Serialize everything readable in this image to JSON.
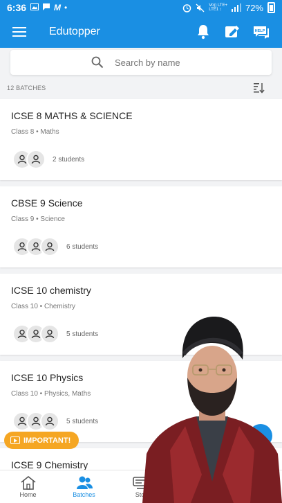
{
  "status_bar": {
    "time": "6:36",
    "network": "Vo)) LTE+\nLTE1 ↕",
    "battery": "72%"
  },
  "app_bar": {
    "title": "Edutopper",
    "icons": [
      "menu-icon",
      "bell-icon",
      "edit-icon",
      "help-icon"
    ],
    "help_badge": "HELP"
  },
  "search": {
    "placeholder": "Search by name"
  },
  "batches": {
    "count_label": "12 BATCHES",
    "items": [
      {
        "name": "ICSE 8 MATHS & SCIENCE",
        "subtitle": "Class 8 • Maths",
        "students": "2 students",
        "avatars": 2
      },
      {
        "name": "CBSE 9 Science",
        "subtitle": "Class 9 • Science",
        "students": "6 students",
        "avatars": 3
      },
      {
        "name": "ICSE 10 chemistry",
        "subtitle": "Class 10 • Chemistry",
        "students": "5 students",
        "avatars": 3
      },
      {
        "name": "ICSE 10 Physics",
        "subtitle": "Class 10 • Physics, Maths",
        "students": "5 students",
        "avatars": 3
      },
      {
        "name": "ICSE 9 Chemistry",
        "subtitle": "",
        "students": "",
        "avatars": 0
      }
    ]
  },
  "important_button": {
    "label": "IMPORTANT!"
  },
  "bottom_nav": {
    "items": [
      {
        "label": "Home",
        "icon": "home-icon"
      },
      {
        "label": "Batches",
        "icon": "batches-icon"
      },
      {
        "label": "Sto",
        "icon": "store-icon"
      }
    ]
  },
  "colors": {
    "primary": "#1a8fe3",
    "accent": "#f5a623",
    "background": "#f2f3f5"
  }
}
